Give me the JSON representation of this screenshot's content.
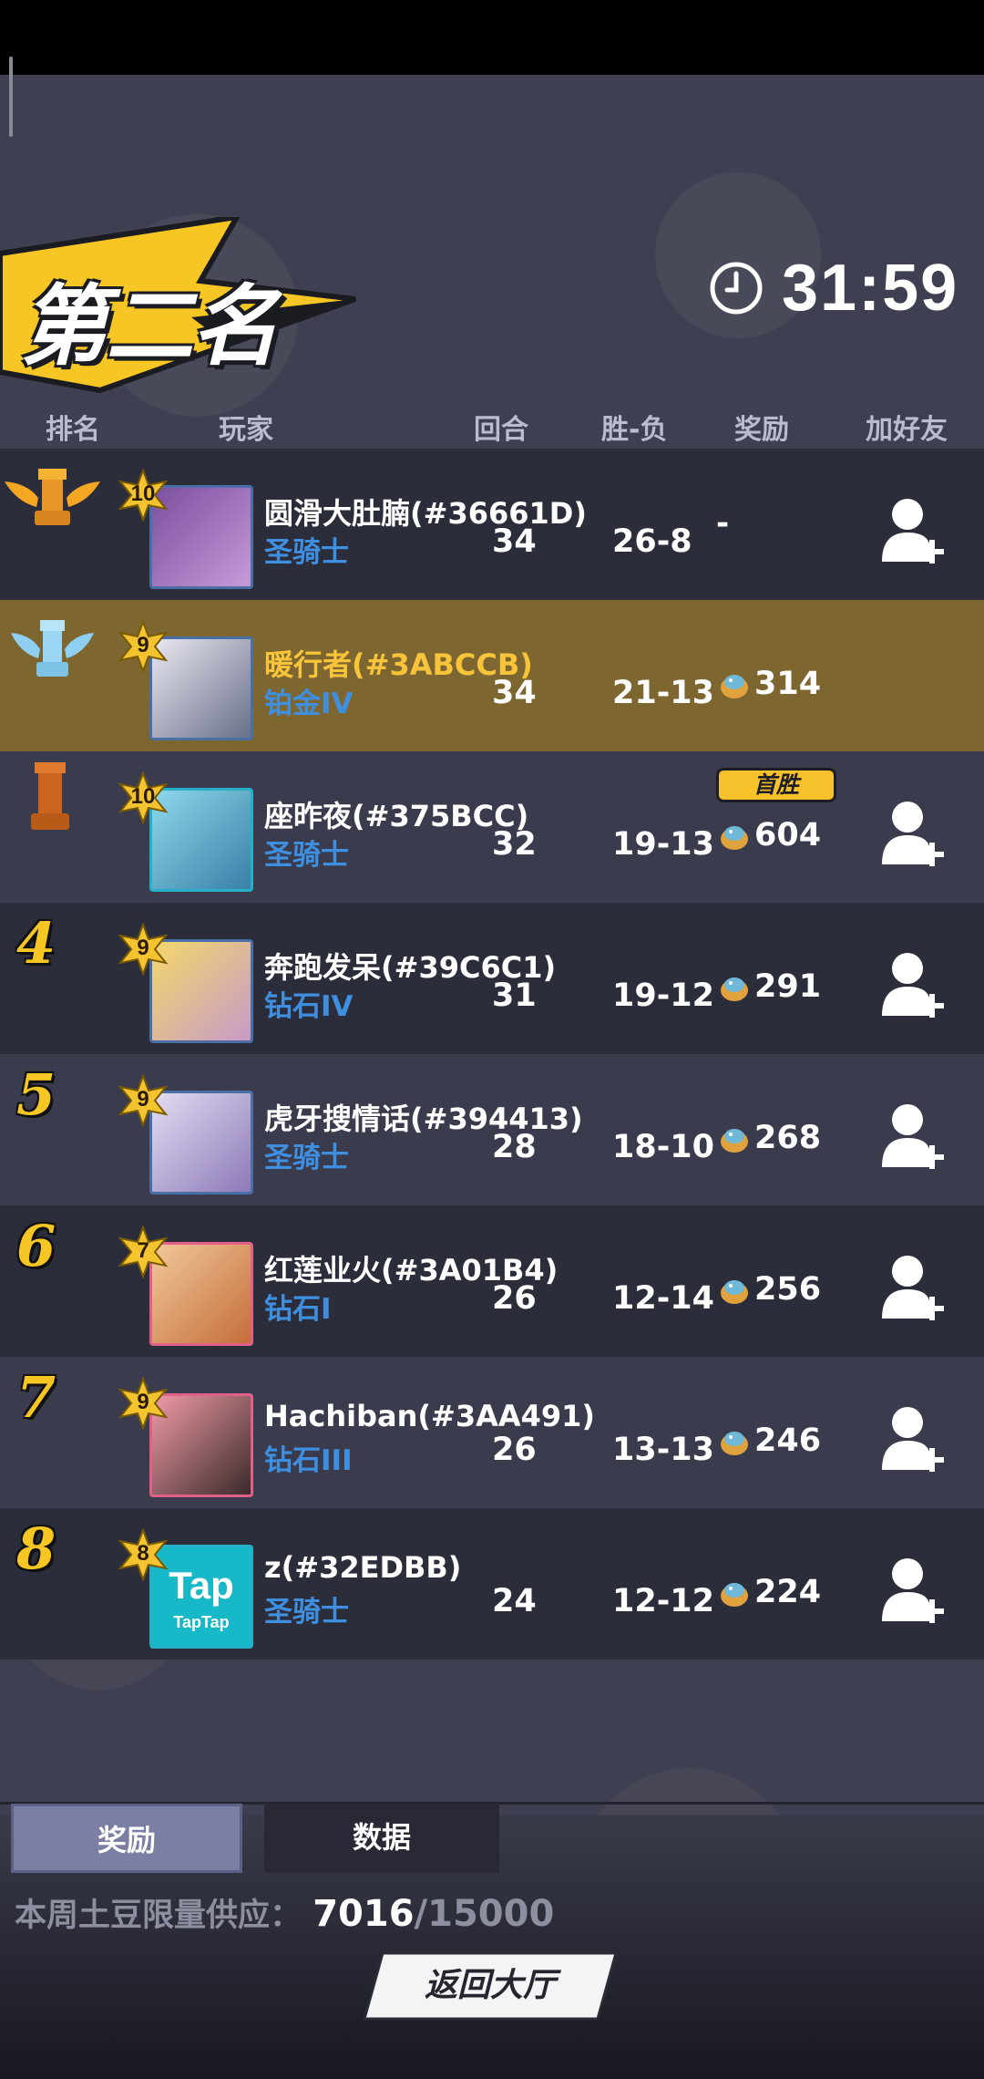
{
  "banner": {
    "title": "第二名"
  },
  "timer": {
    "value": "31:59"
  },
  "columns": {
    "rank": "排名",
    "player": "玩家",
    "rounds": "回合",
    "record": "胜-负",
    "reward": "奖励",
    "add_friend": "加好友"
  },
  "rows": [
    {
      "rank": "1",
      "level": "10",
      "name": "圆滑大肚腩(#36661D)",
      "title": "圣骑士",
      "rounds": "34",
      "record": "26-8",
      "reward": "-",
      "first_win": "",
      "self": false
    },
    {
      "rank": "2",
      "level": "9",
      "name": "暖行者(#3ABCCB)",
      "title": "铂金IV",
      "rounds": "34",
      "record": "21-13",
      "reward": "314",
      "first_win": "",
      "self": true
    },
    {
      "rank": "3",
      "level": "10",
      "name": "座昨夜(#375BCC)",
      "title": "圣骑士",
      "rounds": "32",
      "record": "19-13",
      "reward": "604",
      "first_win": "首胜",
      "self": false
    },
    {
      "rank": "4",
      "level": "9",
      "name": "奔跑发呆(#39C6C1)",
      "title": "钻石IV",
      "rounds": "31",
      "record": "19-12",
      "reward": "291",
      "first_win": "",
      "self": false
    },
    {
      "rank": "5",
      "level": "9",
      "name": "虎牙搜情话(#394413)",
      "title": "圣骑士",
      "rounds": "28",
      "record": "18-10",
      "reward": "268",
      "first_win": "",
      "self": false
    },
    {
      "rank": "6",
      "level": "7",
      "name": "红莲业火(#3A01B4)",
      "title": "钻石I",
      "rounds": "26",
      "record": "12-14",
      "reward": "256",
      "first_win": "",
      "self": false
    },
    {
      "rank": "7",
      "level": "9",
      "name": "Hachiban(#3AA491)",
      "title": "钻石III",
      "rounds": "26",
      "record": "13-13",
      "reward": "246",
      "first_win": "",
      "self": false
    },
    {
      "rank": "8",
      "level": "8",
      "name": "z(#32EDBB)",
      "title": "圣骑士",
      "rounds": "24",
      "record": "12-12",
      "reward": "224",
      "first_win": "",
      "self": false
    }
  ],
  "tabs": {
    "reward": "奖励",
    "stats": "数据"
  },
  "supply": {
    "label": "本周土豆限量供应：",
    "current": "7016",
    "max": "/15000"
  },
  "back_button": "返回大厅",
  "avatar_logo": {
    "main": "Tap",
    "sub": "TapTap"
  },
  "colors": {
    "gold": "#f6c624",
    "highlight_row": "#7d6630",
    "title_blue": "#3f8fe0",
    "dark_row": "#2c2d3b",
    "light_row": "#3a3b4c"
  },
  "icons": {
    "timer": "clock-icon",
    "reward": "potato-coin-icon",
    "add_friend": "add-user-icon",
    "rank1": "gold-rook-wings-icon",
    "rank2": "silver-rook-wings-icon",
    "rank3": "bronze-rook-icon",
    "level": "star-badge-icon"
  }
}
